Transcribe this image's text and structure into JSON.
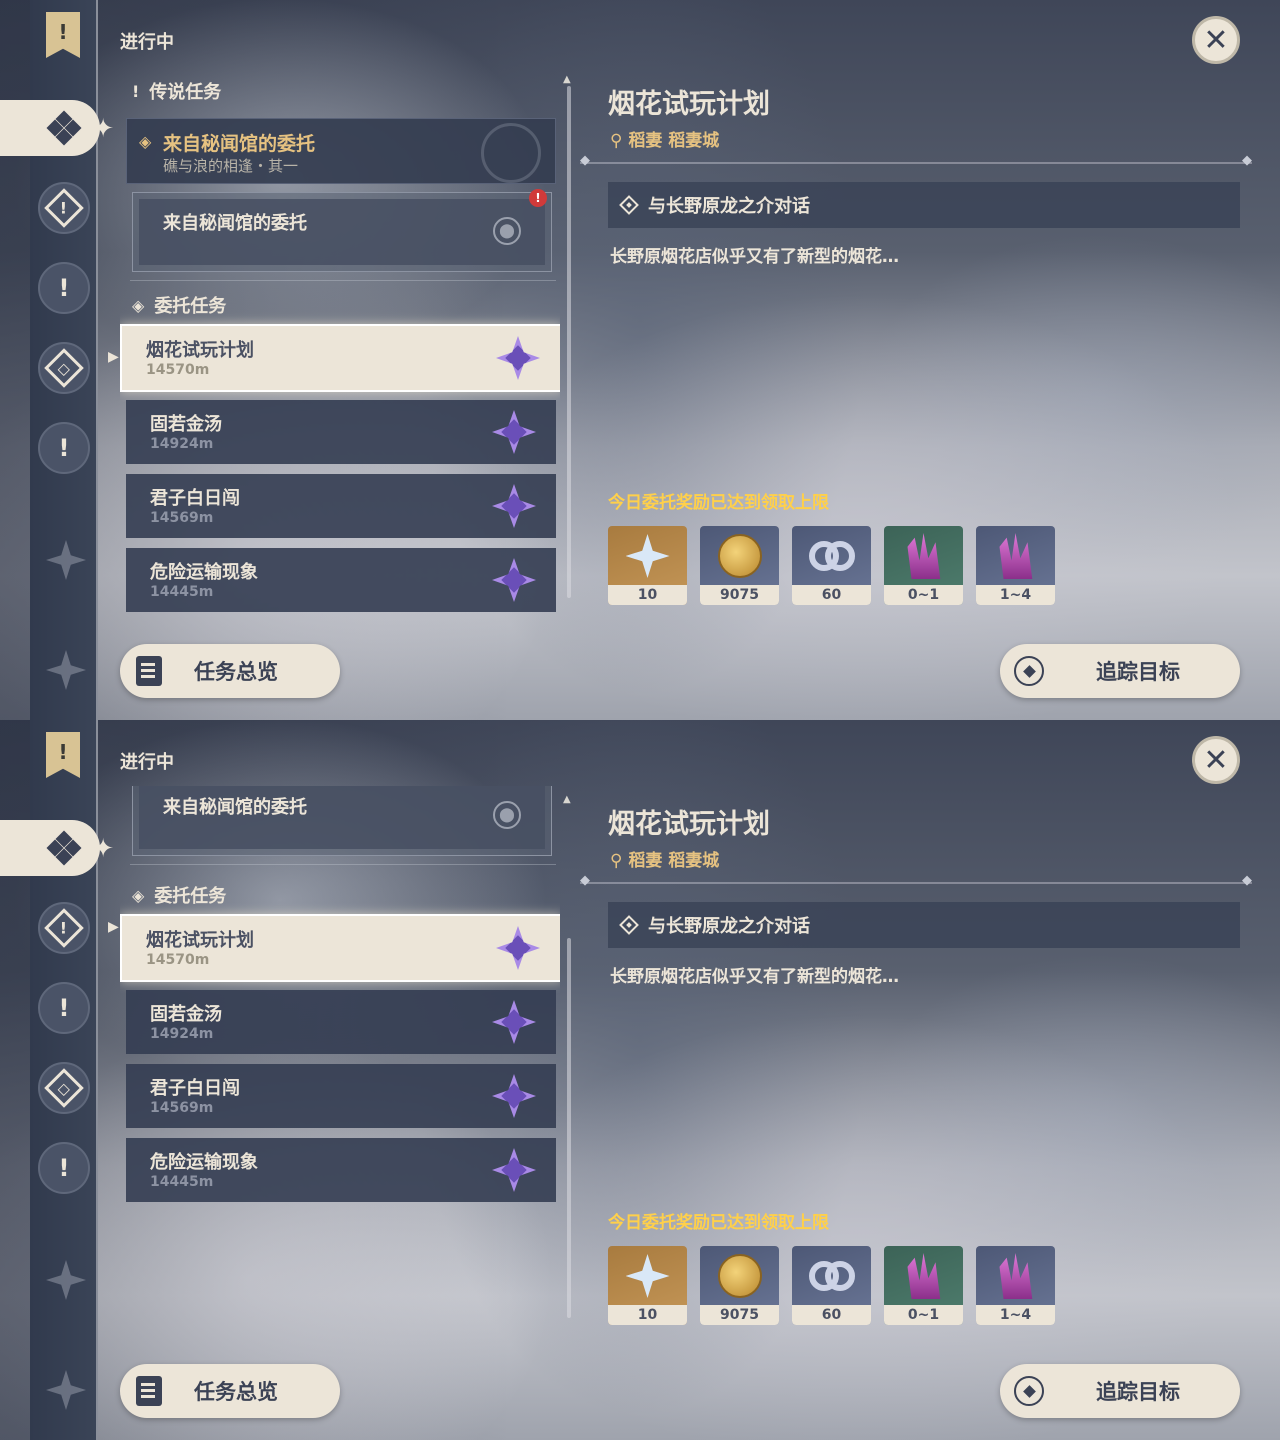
{
  "colors": {
    "accent_gold": "#e6c281",
    "limit_yellow": "#ffd04a",
    "panel_dark": "#343d52",
    "cream": "#ece5d8",
    "quest_purple": "#a98ae6"
  },
  "header": {
    "section_label": "进行中",
    "close_icon": "close-icon"
  },
  "rail": {
    "icons": [
      "banner-icon",
      "daily-commission-icon",
      "world-quest-icon",
      "story-quest-icon",
      "archon-quest-icon",
      "alert-icon"
    ]
  },
  "legend_group": {
    "label": "传说任务"
  },
  "legend_quest": {
    "title": "来自秘闻馆的委托",
    "subtitle": "礁与浪的相逢・其一"
  },
  "legend_sub": {
    "title": "来自秘闻馆的委托",
    "alert": "!"
  },
  "commission_group": {
    "label": "委托任务"
  },
  "commissions": [
    {
      "title": "烟花试玩计划",
      "distance": "14570m"
    },
    {
      "title": "固若金汤",
      "distance": "14924m"
    },
    {
      "title": "君子白日闯",
      "distance": "14569m"
    },
    {
      "title": "危险运输现象",
      "distance": "14445m"
    }
  ],
  "detail": {
    "title": "烟花试玩计划",
    "location": "稻妻 稻妻城",
    "objective": "与长野原龙之介对话",
    "description": "长野原烟花店似乎又有了新型的烟花…",
    "reward_limit": "今日委托奖励已达到领取上限",
    "rewards": [
      {
        "name": "primogem-icon",
        "count": "10"
      },
      {
        "name": "mora-icon",
        "count": "9075"
      },
      {
        "name": "companionship-exp-icon",
        "count": "60"
      },
      {
        "name": "crystal-chunk-icon",
        "count": "0~1"
      },
      {
        "name": "crystal-cluster-icon",
        "count": "1~4"
      }
    ]
  },
  "buttons": {
    "overview": "任务总览",
    "track": "追踪目标"
  }
}
